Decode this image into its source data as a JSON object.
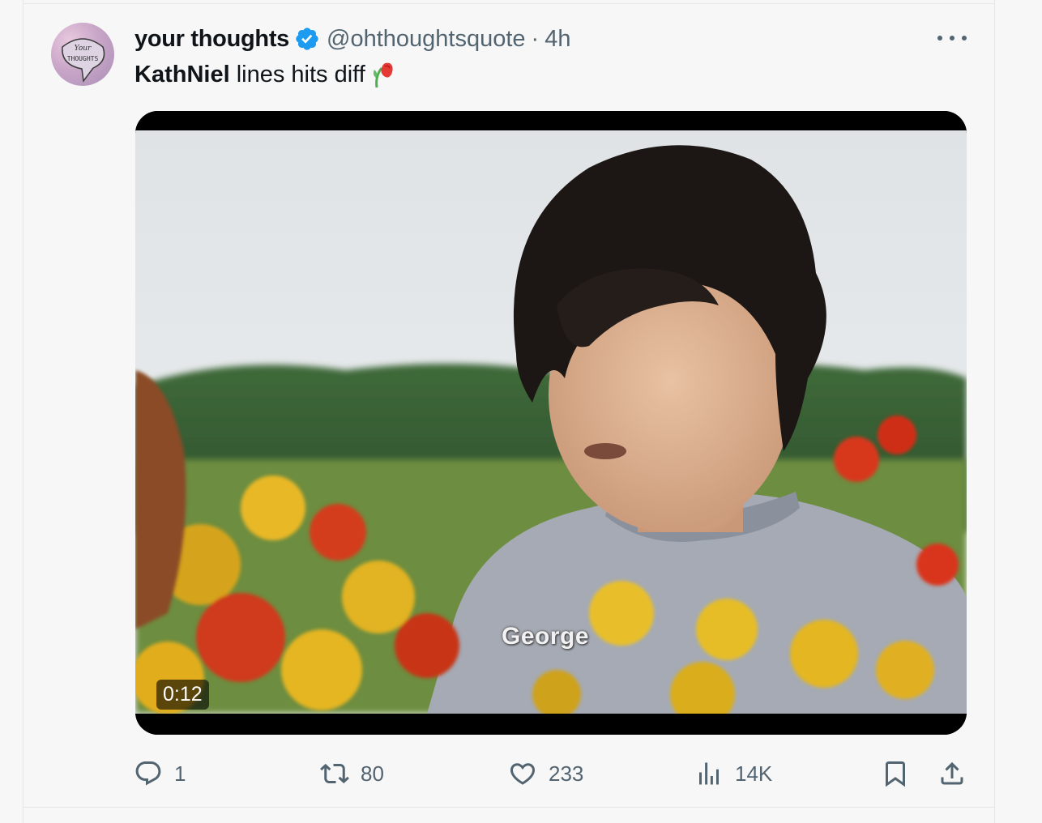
{
  "tweet": {
    "display_name": "your thoughts",
    "handle": "@ohthoughtsquote",
    "separator": "·",
    "time": "4h",
    "text_bold": "KathNiel",
    "text_rest": " lines hits diff",
    "avatar_text_top": "Your",
    "avatar_text_bottom": "THOUGHTS"
  },
  "media": {
    "caption": "George",
    "duration": "0:12"
  },
  "actions": {
    "replies": "1",
    "retweets": "80",
    "likes": "233",
    "views": "14K"
  },
  "colors": {
    "accent": "#1d9bf0",
    "muted": "#536471"
  },
  "icons": {
    "verified": "verified-badge-icon",
    "more": "more-dots-icon",
    "reply": "reply-icon",
    "retweet": "retweet-icon",
    "like": "heart-icon",
    "views": "views-chart-icon",
    "bookmark": "bookmark-icon",
    "share": "share-icon"
  }
}
